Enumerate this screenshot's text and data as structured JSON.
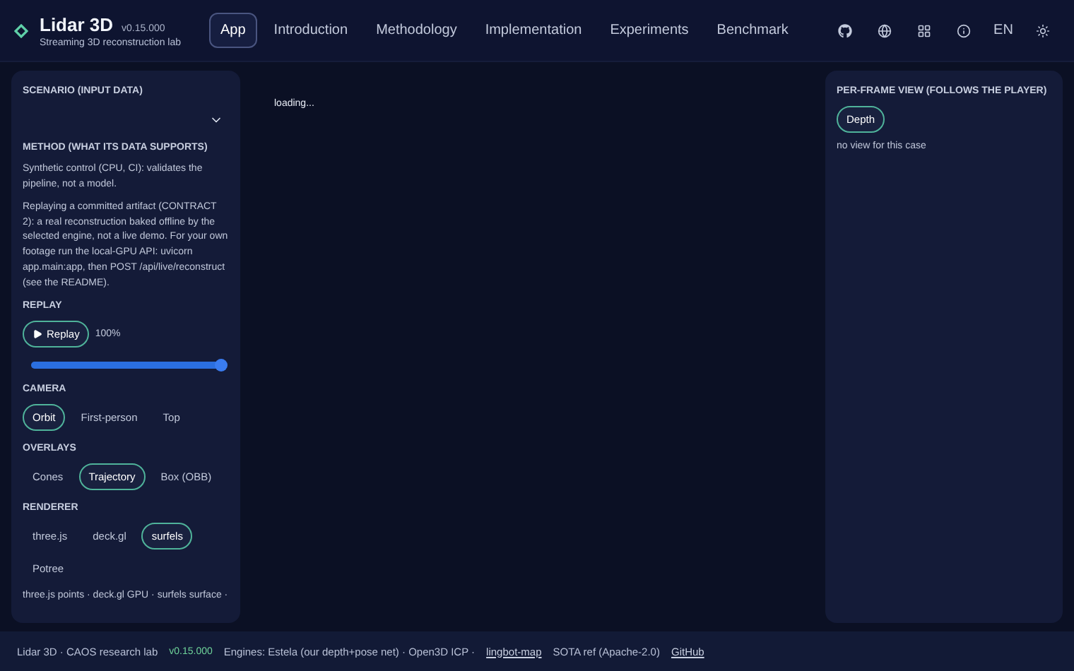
{
  "brand": {
    "name": "Lidar 3D",
    "version": "v0.15.000",
    "tagline": "Streaming 3D reconstruction lab"
  },
  "nav": [
    {
      "label": "App",
      "selected": true
    },
    {
      "label": "Introduction",
      "selected": false
    },
    {
      "label": "Methodology",
      "selected": false
    },
    {
      "label": "Implementation",
      "selected": false
    },
    {
      "label": "Experiments",
      "selected": false
    },
    {
      "label": "Benchmark",
      "selected": false
    }
  ],
  "language": "EN",
  "left_panel": {
    "scenario": {
      "label": "SCENARIO (INPUT DATA)"
    },
    "method": {
      "label": "METHOD (WHAT ITS DATA SUPPORTS)",
      "paragraphs": [
        "Synthetic control (CPU, CI): validates the pipeline, not a model.",
        "Replaying a committed artifact (CONTRACT 2): a real reconstruction baked offline by the selected engine, not a live demo. For your own footage run the local-GPU API: uvicorn app.main:app, then POST /api/live/reconstruct (see the README)."
      ]
    },
    "replay": {
      "label": "REPLAY",
      "button": "Replay",
      "reading": "100%",
      "level": 1
    },
    "groups": [
      {
        "label": "CAMERA",
        "options": [
          {
            "label": "Orbit",
            "selected": true
          },
          {
            "label": "First-person",
            "selected": false
          },
          {
            "label": "Top",
            "selected": false
          }
        ]
      },
      {
        "label": "OVERLAYS",
        "options": [
          {
            "label": "Cones",
            "selected": false
          },
          {
            "label": "Trajectory",
            "selected": true
          },
          {
            "label": "Box (OBB)",
            "selected": false
          }
        ]
      },
      {
        "label": "RENDERER",
        "options": [
          {
            "label": "three.js",
            "selected": false
          },
          {
            "label": "deck.gl",
            "selected": false
          },
          {
            "label": "surfels",
            "selected": true
          },
          {
            "label": "Potree",
            "selected": false
          }
        ]
      }
    ],
    "note": "three.js points · deck.gl GPU · surfels surface ·"
  },
  "viewer": {
    "status": "loading..."
  },
  "right_panel": {
    "label": "PER-FRAME VIEW (FOLLOWS THE PLAYER)",
    "options": [
      {
        "label": "Depth",
        "selected": true
      }
    ],
    "message": "no view for this case"
  },
  "footer": {
    "lab": "Lidar 3D · CAOS research lab",
    "version": "v0.15.000",
    "engines": "Engines: Estela (our depth+pose net) · Open3D ICP ·",
    "engine_link": "lingbot-map",
    "engine_suffix": "SOTA ref (Apache-2.0)",
    "github": "GitHub"
  }
}
